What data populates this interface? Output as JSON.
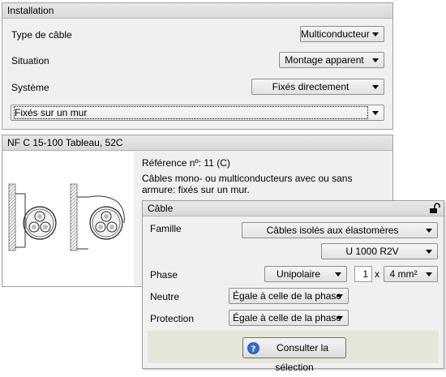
{
  "installation": {
    "title": "Installation",
    "cable_type": {
      "label": "Type de câble",
      "value": "Multiconducteur"
    },
    "situation": {
      "label": "Situation",
      "value": "Montage apparent"
    },
    "systeme": {
      "label": "Système",
      "value": "Fixés directement"
    },
    "detail": {
      "value": "Fixés sur un mur"
    }
  },
  "norm": {
    "title": "NF C 15-100 Tableau, 52C",
    "reference": "Référence nº: 11 (C)",
    "description": "Câbles mono- ou multiconducteurs avec ou sans armure: fixés sur un mur."
  },
  "cable": {
    "title": "Câble",
    "famille": {
      "label": "Famille",
      "value": "Câbles isolés aux élastomères",
      "type_value": "U 1000 R2V"
    },
    "phase": {
      "label": "Phase",
      "value": "Unipolaire",
      "count": "1",
      "multiply": "x",
      "section": "4 mm²"
    },
    "neutre": {
      "label": "Neutre",
      "value": "Égale à celle de la phase"
    },
    "protection": {
      "label": "Protection",
      "value": "Égale à celle de la phase"
    },
    "consult_button": "Consulter la sélection"
  }
}
